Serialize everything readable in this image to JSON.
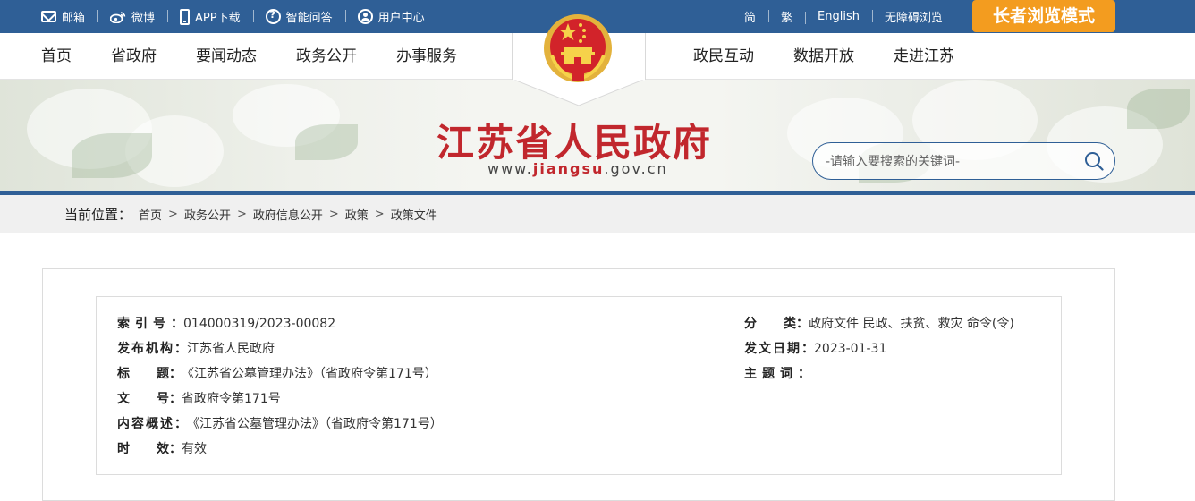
{
  "topbar": {
    "left_items": [
      {
        "label": "邮箱",
        "icon": "mail-icon"
      },
      {
        "label": "微博",
        "icon": "weibo-icon"
      },
      {
        "label": "APP下载",
        "icon": "phone-icon"
      },
      {
        "label": "智能问答",
        "icon": "qa-icon"
      },
      {
        "label": "用户中心",
        "icon": "user-icon"
      }
    ],
    "right_items": [
      "简",
      "繁",
      "English",
      "无障碍浏览"
    ],
    "elder_mode": "长者浏览模式",
    "bar_color": "#2f5f96",
    "elder_color": "#f39c1f"
  },
  "nav": {
    "left": [
      "首页",
      "省政府",
      "要闻动态",
      "政务公开",
      "办事服务"
    ],
    "right": [
      "政民互动",
      "数据开放",
      "走进江苏"
    ]
  },
  "banner": {
    "title": "江苏省人民政府",
    "url_prefix": "www.",
    "url_domain": "jiangsu",
    "url_suffix": ".gov.cn",
    "title_color": "#c1272d"
  },
  "search": {
    "placeholder": "-请输入要搜索的关键词-"
  },
  "breadcrumb": {
    "label": "当前位置：",
    "items": [
      "首页",
      "政务公开",
      "政府信息公开",
      "政策",
      "政策文件"
    ],
    "separator": ">"
  },
  "info": {
    "left": [
      {
        "key": "索 引 号：",
        "value": "014000319/2023-00082"
      },
      {
        "key": "发布机构：",
        "value": "江苏省人民政府"
      },
      {
        "key": "标    题：",
        "value": "《江苏省公墓管理办法》（省政府令第171号）"
      },
      {
        "key": "文    号：",
        "value": "省政府令第171号"
      },
      {
        "key": "内容概述：",
        "value": "《江苏省公墓管理办法》（省政府令第171号）"
      },
      {
        "key": "时    效：",
        "value": "有效"
      }
    ],
    "right": [
      {
        "key": "分    类：",
        "value": "政府文件 民政、扶贫、救灾 命令(令)"
      },
      {
        "key": "发文日期：",
        "value": "2023-01-31"
      },
      {
        "key": "主 题 词：",
        "value": ""
      }
    ]
  }
}
